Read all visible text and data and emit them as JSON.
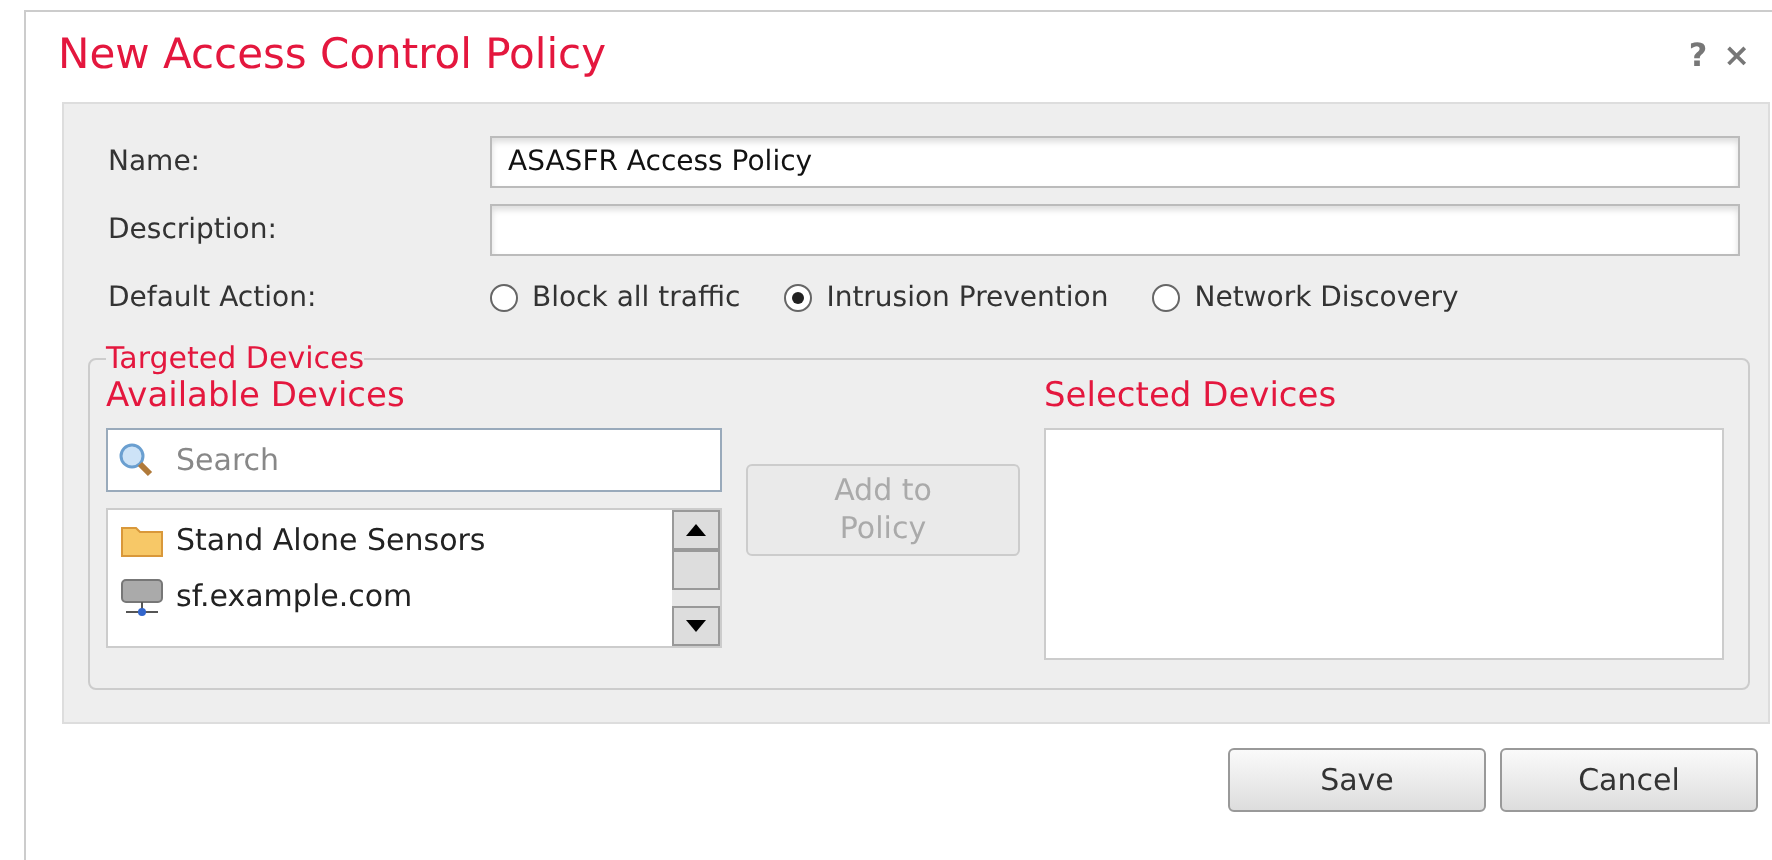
{
  "window": {
    "title": "New Access Control Policy",
    "help": "?",
    "close": "×"
  },
  "form": {
    "name": {
      "label": "Name:",
      "value": "ASASFR Access Policy"
    },
    "description": {
      "label": "Description:"
    },
    "default_action": {
      "label": "Default Action:",
      "options": [
        {
          "label": "Block all traffic",
          "selected": false
        },
        {
          "label": "Intrusion Prevention",
          "selected": true
        },
        {
          "label": "Network Discovery",
          "selected": false
        }
      ]
    }
  },
  "targeted_devices": {
    "legend": "Targeted Devices",
    "available": {
      "title": "Available Devices",
      "search": {
        "placeholder": "Search"
      },
      "items": [
        {
          "label": "Stand Alone Sensors",
          "kind": "folder"
        },
        {
          "label": "sf.example.com",
          "kind": "device"
        }
      ]
    },
    "add_button": {
      "label": "Add to Policy",
      "disabled": true
    },
    "selected": {
      "title": "Selected Devices"
    }
  },
  "buttons": [
    {
      "label": "Save"
    },
    {
      "label": "Cancel"
    }
  ]
}
